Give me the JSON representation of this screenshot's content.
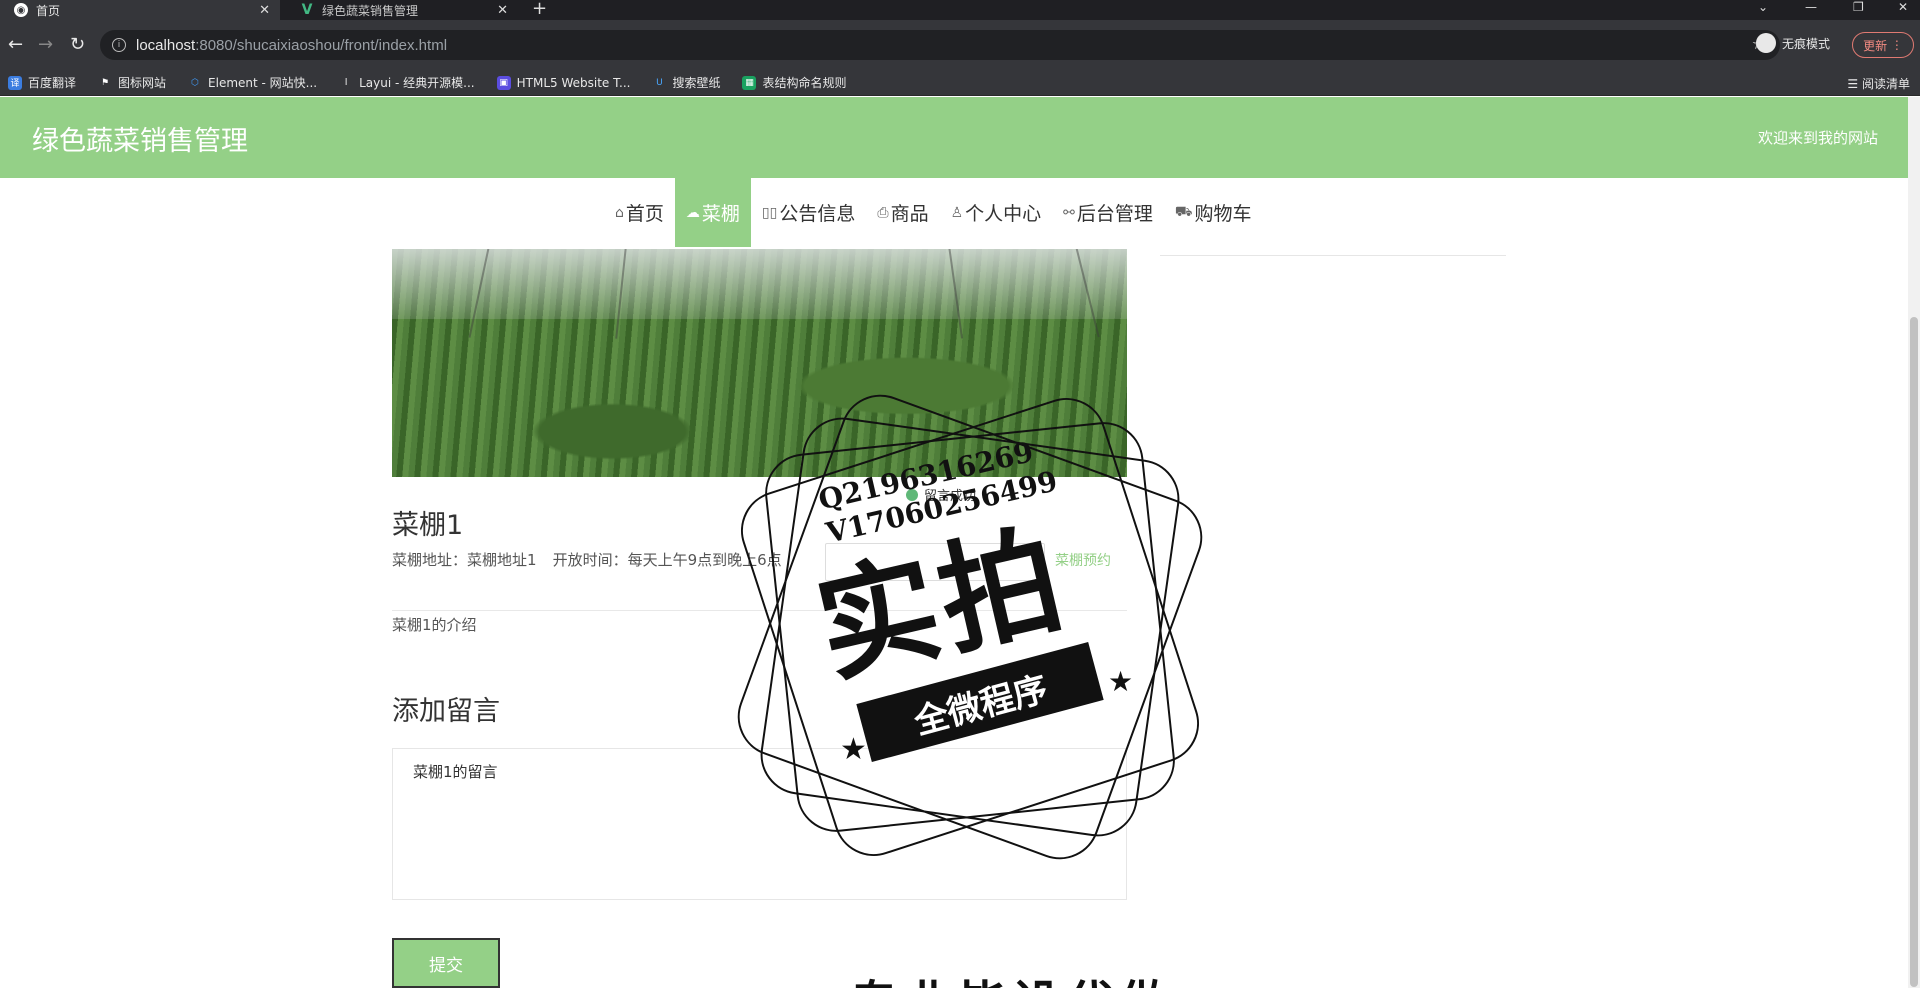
{
  "browser": {
    "tabs": [
      {
        "title": "首页",
        "active": true
      },
      {
        "title": "绿色蔬菜销售管理",
        "active": false
      }
    ],
    "url_host": "localhost",
    "url_rest": ":8080/shucaixiaoshou/front/index.html",
    "incognito_label": "无痕模式",
    "update_label": "更新",
    "bookmarks": [
      "百度翻译",
      "图标网站",
      "Element - 网站快...",
      "Layui - 经典开源模...",
      "HTML5 Website T...",
      "搜索壁纸",
      "表结构命名规则"
    ],
    "reading_list": "阅读清单"
  },
  "site": {
    "title": "绿色蔬菜销售管理",
    "welcome": "欢迎来到我的网站"
  },
  "nav": [
    {
      "label": "首页",
      "icon": "home-icon",
      "glyph": "⌂",
      "active": false
    },
    {
      "label": "菜棚",
      "icon": "greenhouse-icon",
      "glyph": "☁",
      "active": true
    },
    {
      "label": "公告信息",
      "icon": "notice-icon",
      "glyph": "▯▯",
      "active": false
    },
    {
      "label": "商品",
      "icon": "goods-icon",
      "glyph": "⎙",
      "active": false
    },
    {
      "label": "个人中心",
      "icon": "user-icon",
      "glyph": "♙",
      "active": false
    },
    {
      "label": "后台管理",
      "icon": "link-icon",
      "glyph": "⚯",
      "active": false
    },
    {
      "label": "购物车",
      "icon": "cart-icon",
      "glyph": "⛟",
      "active": false
    }
  ],
  "greenhouse": {
    "name": "菜棚1",
    "address_label": "菜棚地址：",
    "address": "菜棚地址1",
    "hours_label": "开放时间：",
    "hours": "每天上午9点到晚上6点",
    "reserve_button": "菜棚预约",
    "intro": "菜棚1的介绍"
  },
  "toast": "留言成功",
  "comment": {
    "heading": "添加留言",
    "value": "菜棚1的留言",
    "submit_label": "提交"
  },
  "watermark": {
    "contact_line1": "Q2196316269",
    "contact_line2": "V17060256499",
    "main": "实拍",
    "ribbon": "全微程序",
    "bottom": "专业毕设代做"
  },
  "colors": {
    "brand_green": "#94d087"
  }
}
